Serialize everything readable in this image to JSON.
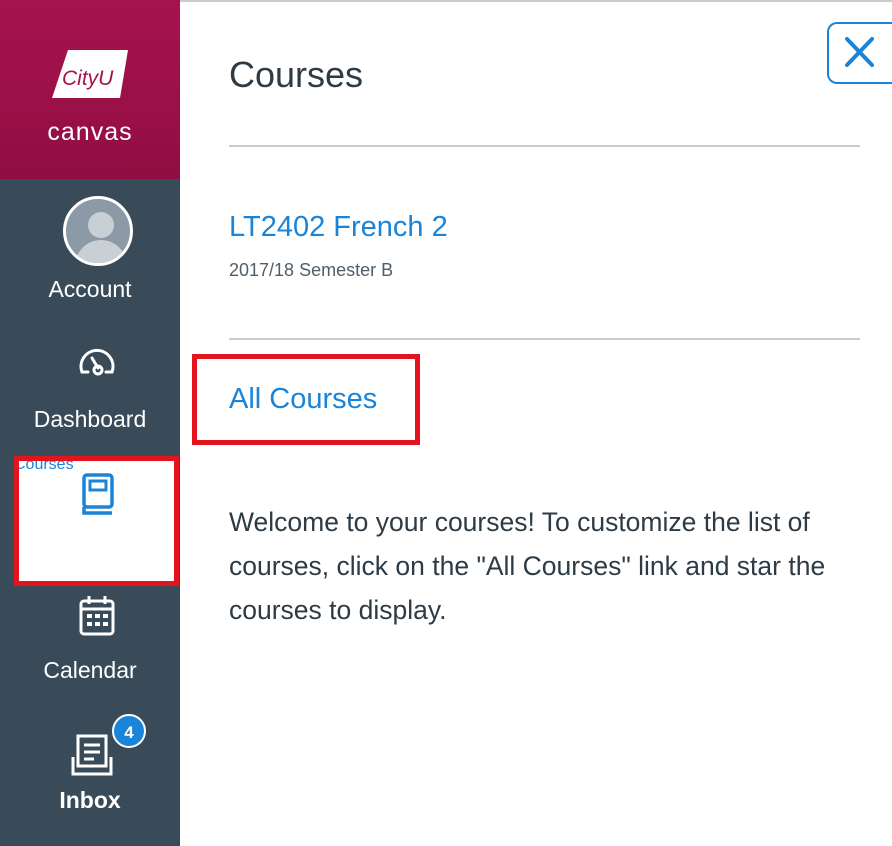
{
  "brand": {
    "logo_text": "CityU",
    "word": "canvas"
  },
  "nav": {
    "account": "Account",
    "dashboard": "Dashboard",
    "courses": "Courses",
    "calendar": "Calendar",
    "inbox": "Inbox",
    "inbox_badge": "4"
  },
  "tray": {
    "title": "Courses",
    "close_icon": "close-icon",
    "course": {
      "name": "LT2402 French 2",
      "term": "2017/18 Semester B"
    },
    "all_courses": "All Courses",
    "welcome": "Welcome to your courses! To customize the list of courses, click on the \"All Courses\" link and star the courses to display."
  },
  "colors": {
    "nav_bg": "#394b58",
    "brand": "#a5134f",
    "link": "#1a84d8",
    "highlight": "#e3141d"
  }
}
